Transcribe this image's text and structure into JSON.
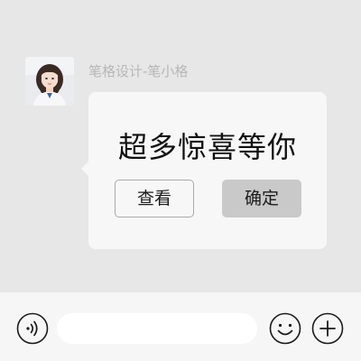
{
  "chat": {
    "sender_name": "笔格设计-笔小格",
    "message": {
      "title": "超多惊喜等你",
      "view_label": "查看",
      "confirm_label": "确定"
    }
  },
  "input_bar": {
    "text_value": "",
    "icons": {
      "voice": "voice-icon",
      "emoji": "emoji-icon",
      "more": "plus-icon"
    }
  },
  "colors": {
    "chat_background": "#e7e7e7",
    "bubble_background": "#f7f7f7",
    "confirm_button": "#c9c9c9",
    "input_bar_background": "#f6f6f6",
    "sender_name_text": "#b7b7b7"
  }
}
